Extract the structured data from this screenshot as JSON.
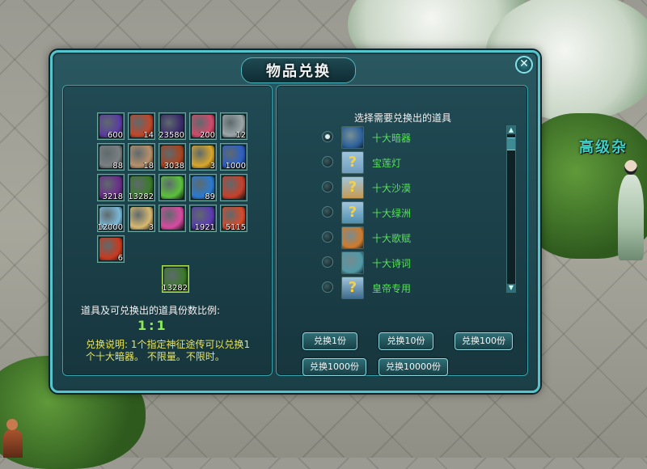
{
  "background": {
    "sign_text": "高级杂"
  },
  "dialog": {
    "title": "物品兑换",
    "close_symbol": "✕",
    "left": {
      "slots": [
        {
          "qty": "600",
          "icon": "dark-claw-icon",
          "color": "#5b3ca0"
        },
        {
          "qty": "14",
          "icon": "scroll-pouch-icon",
          "color": "#c0472a"
        },
        {
          "qty": "23580",
          "icon": "shadow-ball-icon",
          "color": "#3a2a6a"
        },
        {
          "qty": "200",
          "icon": "pink-gem-icon",
          "color": "#d04a6a"
        },
        {
          "qty": "12",
          "icon": "silver-chain-icon",
          "color": "#9aa6a8"
        },
        {
          "qty": "88",
          "icon": "iron-claw-icon",
          "color": "#7a7f82"
        },
        {
          "qty": "18",
          "icon": "bandage-scroll-icon",
          "color": "#b8906a"
        },
        {
          "qty": "3038",
          "icon": "red-book-icon",
          "color": "#a8431e"
        },
        {
          "qty": "3",
          "icon": "gold-scroll-icon",
          "color": "#d8a62a"
        },
        {
          "qty": "1000",
          "icon": "blue-crystal-icon",
          "color": "#2c5ec4"
        },
        {
          "qty": "3218",
          "icon": "purple-flower-icon",
          "color": "#6a2d8a"
        },
        {
          "qty": "13282",
          "icon": "green-manual-icon",
          "color": "#3a7a2a"
        },
        {
          "qty": "",
          "icon": "green-leaf-icon",
          "color": "#5ac23a"
        },
        {
          "qty": "89",
          "icon": "blue-orb-icon",
          "color": "#2a7ad0"
        },
        {
          "qty": "",
          "icon": "red-feather-icon",
          "color": "#c8402a"
        },
        {
          "qty": "12000",
          "icon": "crystal-ball-icon",
          "color": "#7ab8d8"
        },
        {
          "qty": "3",
          "icon": "paper-note-icon",
          "color": "#d8b870"
        },
        {
          "qty": "",
          "icon": "firework-icon",
          "color": "#d84aa0"
        },
        {
          "qty": "1921",
          "icon": "purple-pearl-icon",
          "color": "#5a3ab0"
        },
        {
          "qty": "5115",
          "icon": "flame-gem-icon",
          "color": "#d84a2a"
        },
        {
          "qty": "6",
          "icon": "red-envelope-icon",
          "color": "#c83a1e"
        }
      ],
      "selected": {
        "qty": "13282",
        "icon": "green-manual-icon",
        "color": "#3a7a2a"
      },
      "ratio_label": "道具及可兑换出的道具份数比例:",
      "ratio_value": "1:1",
      "description": "兑换说明: 1个指定神征途传可以兑换1个十大暗器。 不限量。不限时。"
    },
    "right": {
      "list_title": "选择需要兑换出的道具",
      "items": [
        {
          "name": "十大暗器",
          "icon": "dark-weapon-icon",
          "selected": true,
          "color": "#2a5f9a"
        },
        {
          "name": "宝莲灯",
          "icon": "question-icon",
          "selected": false,
          "color": "#6f9dbe"
        },
        {
          "name": "十大沙漠",
          "icon": "question-icon",
          "selected": false,
          "color": "#c79a52"
        },
        {
          "name": "十大绿洲",
          "icon": "question-icon",
          "selected": false,
          "color": "#4f8fae"
        },
        {
          "name": "十大歌赋",
          "icon": "orange-book-icon",
          "selected": false,
          "color": "#d07a2a"
        },
        {
          "name": "十大诗词",
          "icon": "poem-card-icon",
          "selected": false,
          "color": "#4f9aa8"
        },
        {
          "name": "皇帝专用",
          "icon": "question-icon",
          "selected": false,
          "color": "#3f6c8e"
        }
      ],
      "buttons": [
        "兑换1份",
        "兑换10份",
        "兑换100份",
        "兑换1000份",
        "兑换10000份"
      ]
    }
  }
}
